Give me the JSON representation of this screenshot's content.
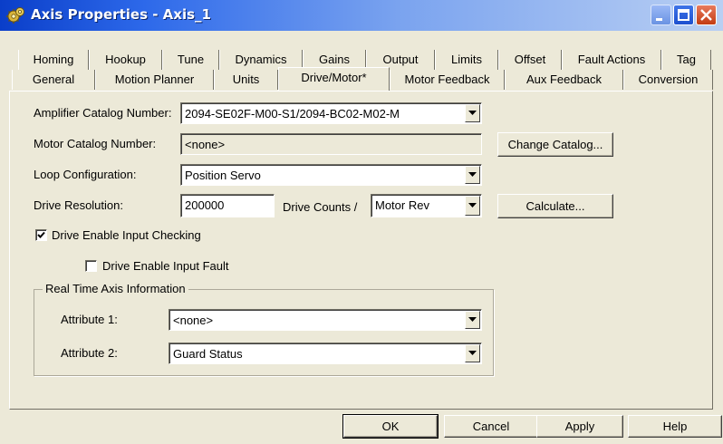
{
  "window": {
    "title": "Axis Properties - Axis_1"
  },
  "tabs_row1": [
    {
      "label": "Homing"
    },
    {
      "label": "Hookup"
    },
    {
      "label": "Tune"
    },
    {
      "label": "Dynamics"
    },
    {
      "label": "Gains"
    },
    {
      "label": "Output"
    },
    {
      "label": "Limits"
    },
    {
      "label": "Offset"
    },
    {
      "label": "Fault Actions"
    },
    {
      "label": "Tag"
    }
  ],
  "tabs_row2": [
    {
      "label": "General"
    },
    {
      "label": "Motion Planner"
    },
    {
      "label": "Units"
    },
    {
      "label": "Drive/Motor*",
      "active": true
    },
    {
      "label": "Motor Feedback"
    },
    {
      "label": "Aux Feedback"
    },
    {
      "label": "Conversion"
    }
  ],
  "form": {
    "amplifier_label": "Amplifier Catalog Number:",
    "amplifier_value": "2094-SE02F-M00-S1/2094-BC02-M02-M",
    "motor_label": "Motor Catalog Number:",
    "motor_value": "<none>",
    "change_catalog_label": "Change Catalog...",
    "loop_label": "Loop Configuration:",
    "loop_value": "Position Servo",
    "resolution_label": "Drive Resolution:",
    "resolution_value": "200000",
    "drive_counts_label": "Drive Counts /",
    "resolution_unit_value": "Motor Rev",
    "calculate_label": "Calculate...",
    "enable_input_checking_label": "Drive Enable Input Checking",
    "enable_input_checking_checked": true,
    "enable_input_fault_label": "Drive Enable Input Fault",
    "enable_input_fault_checked": false
  },
  "realtime": {
    "group_title": "Real Time Axis Information",
    "attr1_label": "Attribute 1:",
    "attr1_value": "<none>",
    "attr2_label": "Attribute 2:",
    "attr2_value": "Guard Status"
  },
  "footer": {
    "ok_label": "OK",
    "cancel_label": "Cancel",
    "apply_label": "Apply",
    "help_label": "Help"
  },
  "colors": {
    "titlebar_start": "#0a3ec9",
    "dialog_bg": "#ece9d8",
    "close_button": "#c33b12"
  },
  "icons": [
    "settings-gears-icon",
    "minimize-icon",
    "maximize-icon",
    "close-icon",
    "dropdown-arrow-icon",
    "checkmark-icon"
  ]
}
